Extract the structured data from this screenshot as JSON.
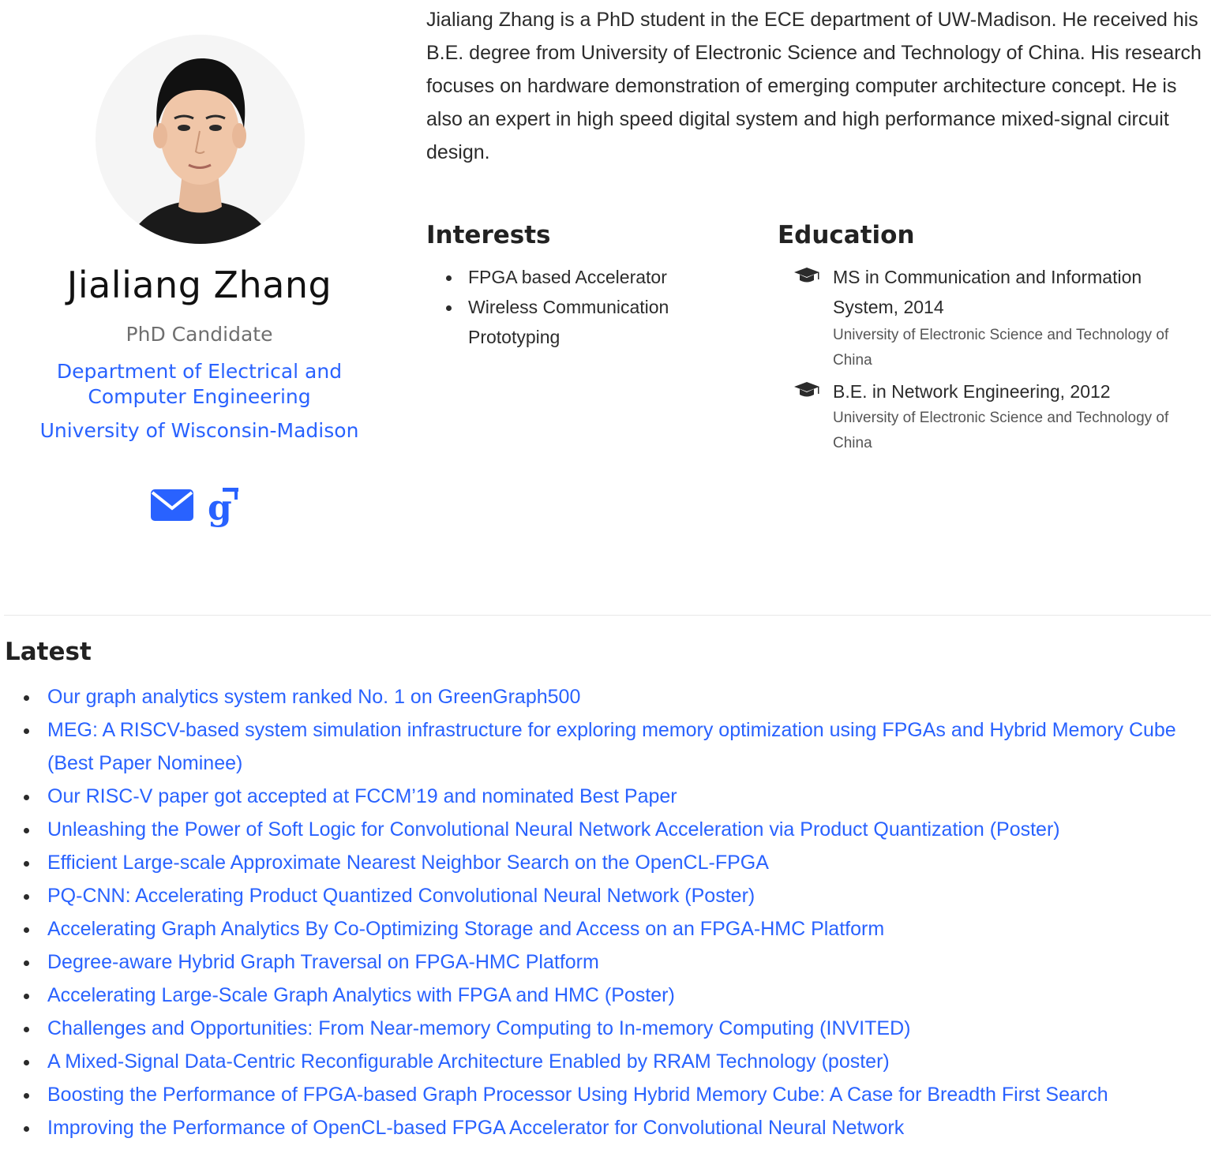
{
  "profile": {
    "name": "Jialiang Zhang",
    "role": "PhD Candidate",
    "department": "Department of Electrical and Computer Engineering",
    "university": "University of Wisconsin-Madison",
    "avatar_icon": "profile-photo",
    "social": [
      {
        "icon": "envelope-icon",
        "label": "email"
      },
      {
        "icon": "google-scholar-icon",
        "label": "Google Scholar"
      }
    ]
  },
  "bio": "Jialiang Zhang is a PhD student in the ECE department of UW-Madison. He received his B.E. degree from University of Electronic Science and Technology of China. His research focuses on hardware demonstration of emerging computer architecture concept. He is also an expert in high speed digital system and high performance mixed-signal circuit design.",
  "interests": {
    "heading": "Interests",
    "items": [
      "FPGA based Accelerator",
      "Wireless Communication Prototyping"
    ]
  },
  "education": {
    "heading": "Education",
    "items": [
      {
        "degree": "MS in Communication and Information System, 2014",
        "institution": "University of Electronic Science and Technology of China"
      },
      {
        "degree": "B.E. in Network Engineering, 2012",
        "institution": "University of Electronic Science and Technology of China"
      }
    ]
  },
  "latest": {
    "heading": "Latest",
    "items": [
      "Our graph analytics system ranked No. 1 on GreenGraph500",
      "MEG: A RISCV-based system simulation infrastructure for exploring memory optimization using FPGAs and Hybrid Memory Cube (Best Paper Nominee)",
      "Our RISC-V paper got accepted at FCCM’19 and nominated Best Paper",
      "Unleashing the Power of Soft Logic for Convolutional Neural Network Acceleration via Product Quantization (Poster)",
      "Efficient Large-scale Approximate Nearest Neighbor Search on the OpenCL-FPGA",
      "PQ-CNN: Accelerating Product Quantized Convolutional Neural Network (Poster)",
      "Accelerating Graph Analytics By Co-Optimizing Storage and Access on an FPGA-HMC Platform",
      "Degree-aware Hybrid Graph Traversal on FPGA-HMC Platform",
      "Accelerating Large-Scale Graph Analytics with FPGA and HMC (Poster)",
      "Challenges and Opportunities: From Near-memory Computing to In-memory Computing (INVITED)",
      "A Mixed-Signal Data-Centric Reconfigurable Architecture Enabled by RRAM Technology (poster)",
      "Boosting the Performance of FPGA-based Graph Processor Using Hybrid Memory Cube: A Case for Breadth First Search",
      "Improving the Performance of OpenCL-based FPGA Accelerator for Convolutional Neural Network"
    ]
  },
  "colors": {
    "link": "#2962ff",
    "text": "#2b2b2b",
    "muted": "#6f6f6f"
  }
}
